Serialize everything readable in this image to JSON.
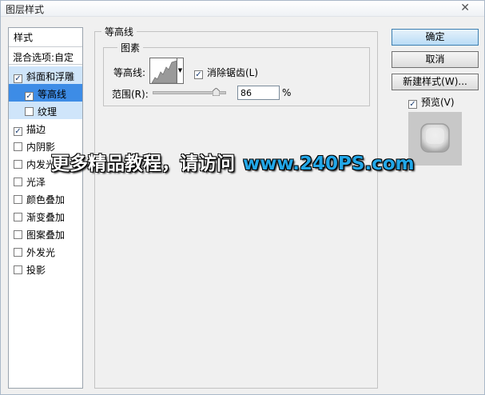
{
  "window": {
    "title": "图层样式",
    "close": "✕"
  },
  "styles": {
    "header": "样式",
    "blend": "混合选项:自定",
    "items": [
      {
        "label": "斜面和浮雕",
        "checked": true,
        "state": "main"
      },
      {
        "label": "等高线",
        "checked": true,
        "state": "current"
      },
      {
        "label": "纹理",
        "checked": false,
        "state": "sub"
      },
      {
        "label": "描边",
        "checked": true,
        "state": ""
      },
      {
        "label": "内阴影",
        "checked": false,
        "state": ""
      },
      {
        "label": "内发光",
        "checked": false,
        "state": ""
      },
      {
        "label": "光泽",
        "checked": false,
        "state": ""
      },
      {
        "label": "颜色叠加",
        "checked": false,
        "state": ""
      },
      {
        "label": "渐变叠加",
        "checked": false,
        "state": ""
      },
      {
        "label": "图案叠加",
        "checked": false,
        "state": ""
      },
      {
        "label": "外发光",
        "checked": false,
        "state": ""
      },
      {
        "label": "投影",
        "checked": false,
        "state": ""
      }
    ]
  },
  "contour_panel": {
    "group_title": "等高线",
    "sub_title": "图素",
    "contour_label": "等高线:",
    "antialias_label": "消除锯齿(L)",
    "antialias_checked": true,
    "range_label": "范围(R):",
    "range_value": "86",
    "range_unit": "%",
    "range_percent": 86
  },
  "buttons": {
    "ok": "确定",
    "cancel": "取消",
    "new_style": "新建样式(W)...",
    "preview_label": "预览(V)",
    "preview_checked": true
  },
  "watermark": {
    "text": "更多精品教程，请访问",
    "url": "www.240PS.com"
  },
  "colors": {
    "selected_item": "#3d8ce6",
    "selected_parent": "#cfe5fa",
    "watermark_url": "#22a7e8"
  }
}
